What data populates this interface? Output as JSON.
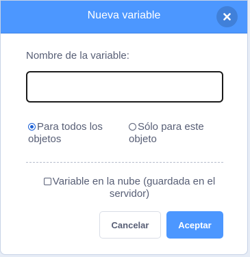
{
  "dialog": {
    "title": "Nueva variable",
    "close_icon": "close-icon",
    "name_label": "Nombre de la variable:",
    "name_input": {
      "value": "",
      "placeholder": ""
    },
    "scope_options": [
      {
        "label": "Para todos los objetos",
        "selected": true
      },
      {
        "label": "Sólo para este objeto",
        "selected": false
      }
    ],
    "cloud_option": {
      "label": "Variable en la nube (guardada en el servidor)",
      "checked": false
    },
    "buttons": {
      "cancel": "Cancelar",
      "ok": "Aceptar"
    }
  },
  "colors": {
    "header": "#4c97ff",
    "text": "#575e75",
    "primary_button": "#4c97ff"
  }
}
